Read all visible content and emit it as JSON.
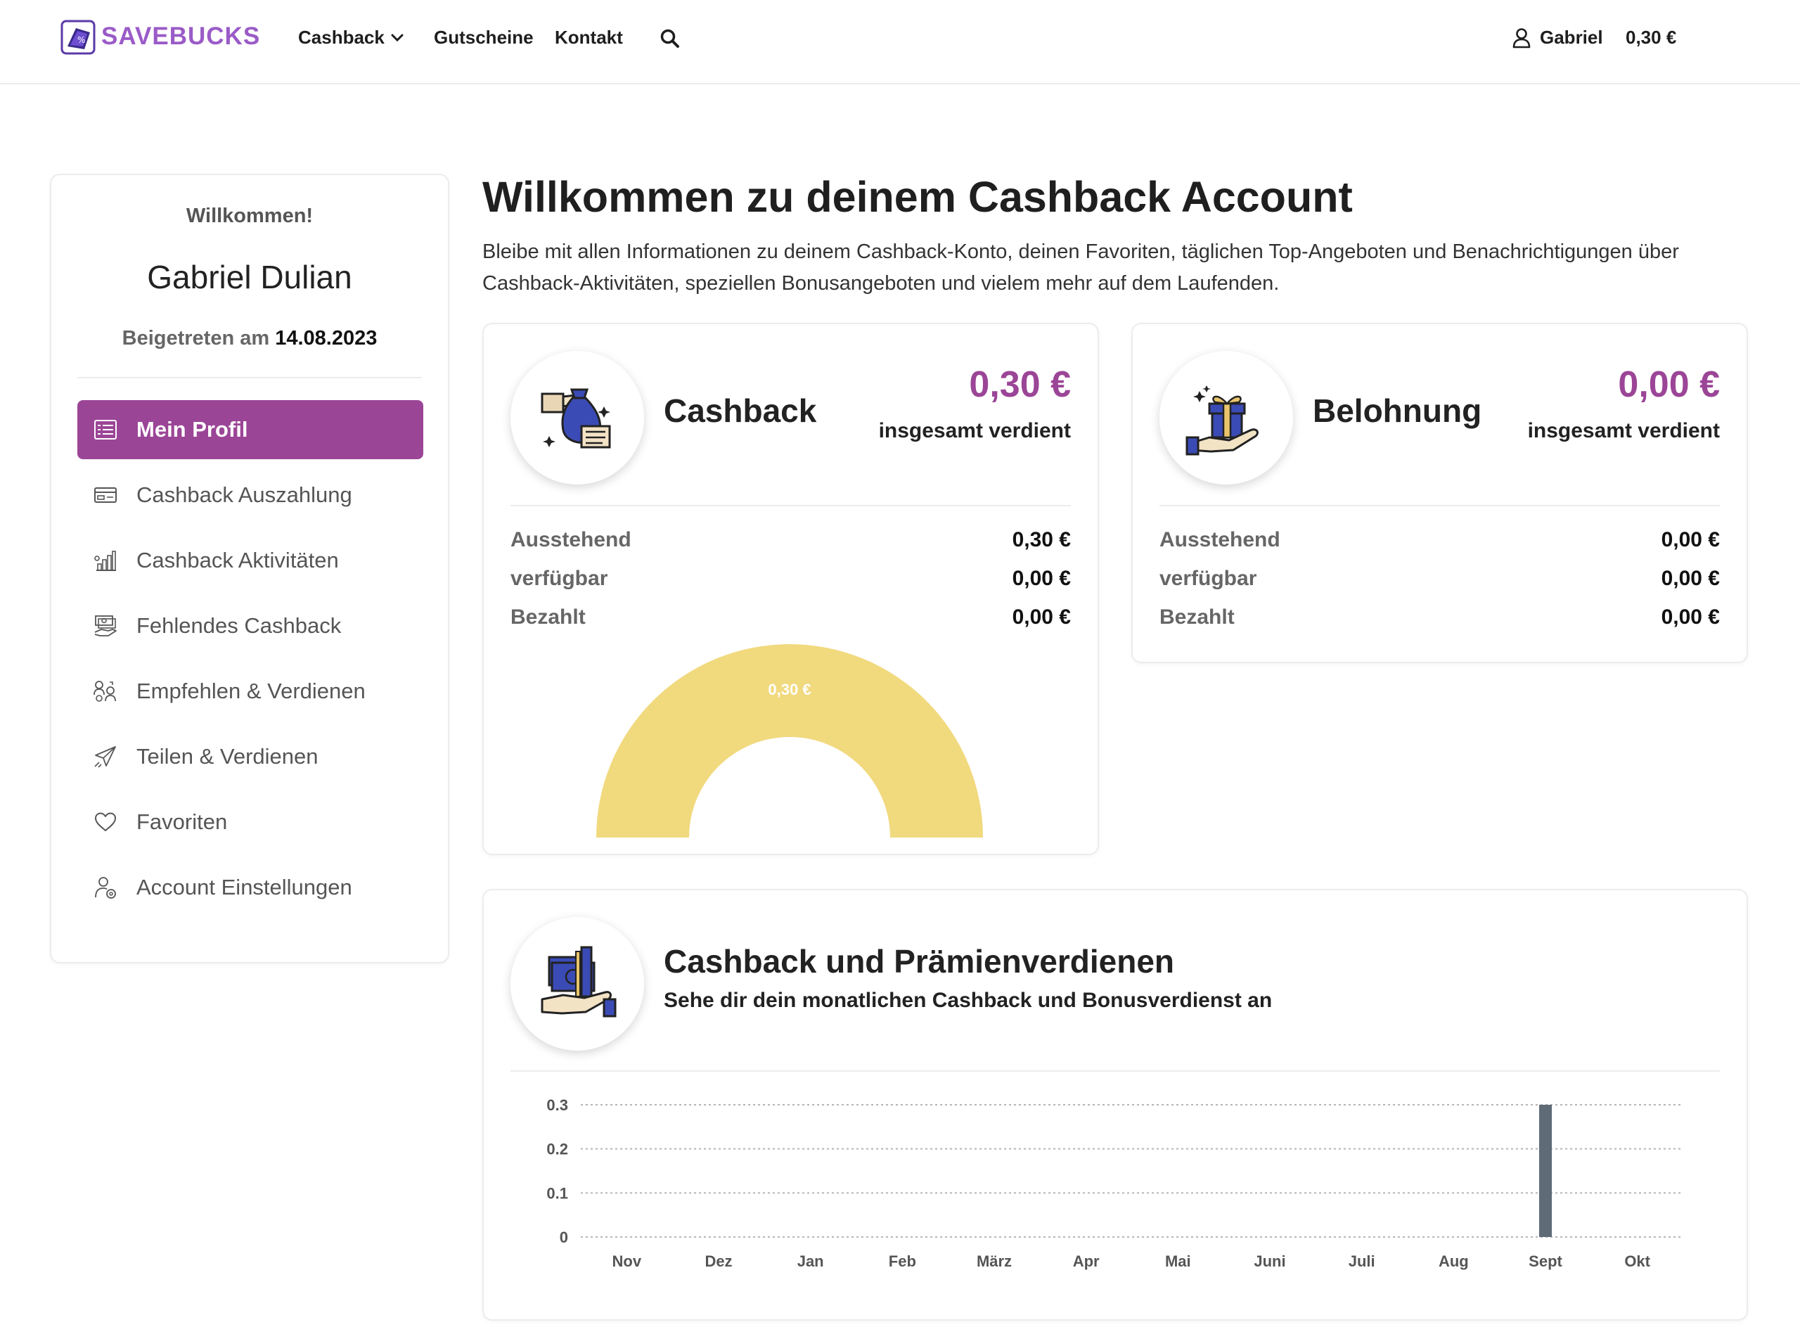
{
  "header": {
    "logo_text": "SAVEBUCKS",
    "nav": {
      "cashback": "Cashback",
      "gutscheine": "Gutscheine",
      "kontakt": "Kontakt"
    },
    "user": "Gabriel",
    "balance": "0,30 €"
  },
  "sidebar": {
    "welcome": "Willkommen!",
    "name": "Gabriel Dulian",
    "joined_label": "Beigetreten am",
    "joined_date": "14.08.2023",
    "items": [
      {
        "label": "Mein Profil",
        "icon": "profile-list-icon"
      },
      {
        "label": "Cashback Auszahlung",
        "icon": "wallet-card-icon"
      },
      {
        "label": "Cashback Aktivitäten",
        "icon": "bar-growth-icon"
      },
      {
        "label": "Fehlendes Cashback",
        "icon": "money-hand-icon"
      },
      {
        "label": "Empfehlen & Verdienen",
        "icon": "referral-people-icon"
      },
      {
        "label": "Teilen & Verdienen",
        "icon": "paper-plane-icon"
      },
      {
        "label": "Favoriten",
        "icon": "heart-icon"
      },
      {
        "label": "Account Einstellungen",
        "icon": "user-settings-icon"
      }
    ]
  },
  "main": {
    "title": "Willkommen zu deinem Cashback Account",
    "description": "Bleibe mit allen Informationen zu deinem Cashback-Konto, deinen Favoriten, täglichen Top-Angeboten und Benachrichtigungen über Cashback-Aktivitäten, speziellen Bonusangeboten und vielem mehr auf dem Laufenden."
  },
  "cashback_card": {
    "label": "Cashback",
    "amount": "0,30 €",
    "sub": "insgesamt verdient",
    "rows": [
      {
        "key": "Ausstehend",
        "value": "0,30 €"
      },
      {
        "key": "verfügbar",
        "value": "0,00 €"
      },
      {
        "key": "Bezahlt",
        "value": "0,00 €"
      }
    ],
    "gauge_label": "0,30 €",
    "gauge_color": "#f1d97e"
  },
  "belohnung_card": {
    "label": "Belohnung",
    "amount": "0,00 €",
    "sub": "insgesamt verdient",
    "rows": [
      {
        "key": "Ausstehend",
        "value": "0,00 €"
      },
      {
        "key": "verfügbar",
        "value": "0,00 €"
      },
      {
        "key": "Bezahlt",
        "value": "0,00 €"
      }
    ]
  },
  "chart_card": {
    "title": "Cashback und Prämienverdienen",
    "subtitle": "Sehe dir dein monatlichen Cashback und Bonusverdienst an"
  },
  "colors": {
    "accent": "#9b4597",
    "bar": "#5f6b77",
    "gauge": "#f1d97e"
  },
  "chart_data": {
    "type": "bar",
    "categories": [
      "Nov",
      "Dez",
      "Jan",
      "Feb",
      "März",
      "Apr",
      "Mai",
      "Juni",
      "Juli",
      "Aug",
      "Sept",
      "Okt"
    ],
    "values": [
      0,
      0,
      0,
      0,
      0,
      0,
      0,
      0,
      0,
      0,
      0.3,
      0
    ],
    "yticks": [
      "0",
      "0.1",
      "0.2",
      "0.3"
    ],
    "ylim": [
      0,
      0.3
    ],
    "grid": true,
    "title": "",
    "xlabel": "",
    "ylabel": ""
  }
}
